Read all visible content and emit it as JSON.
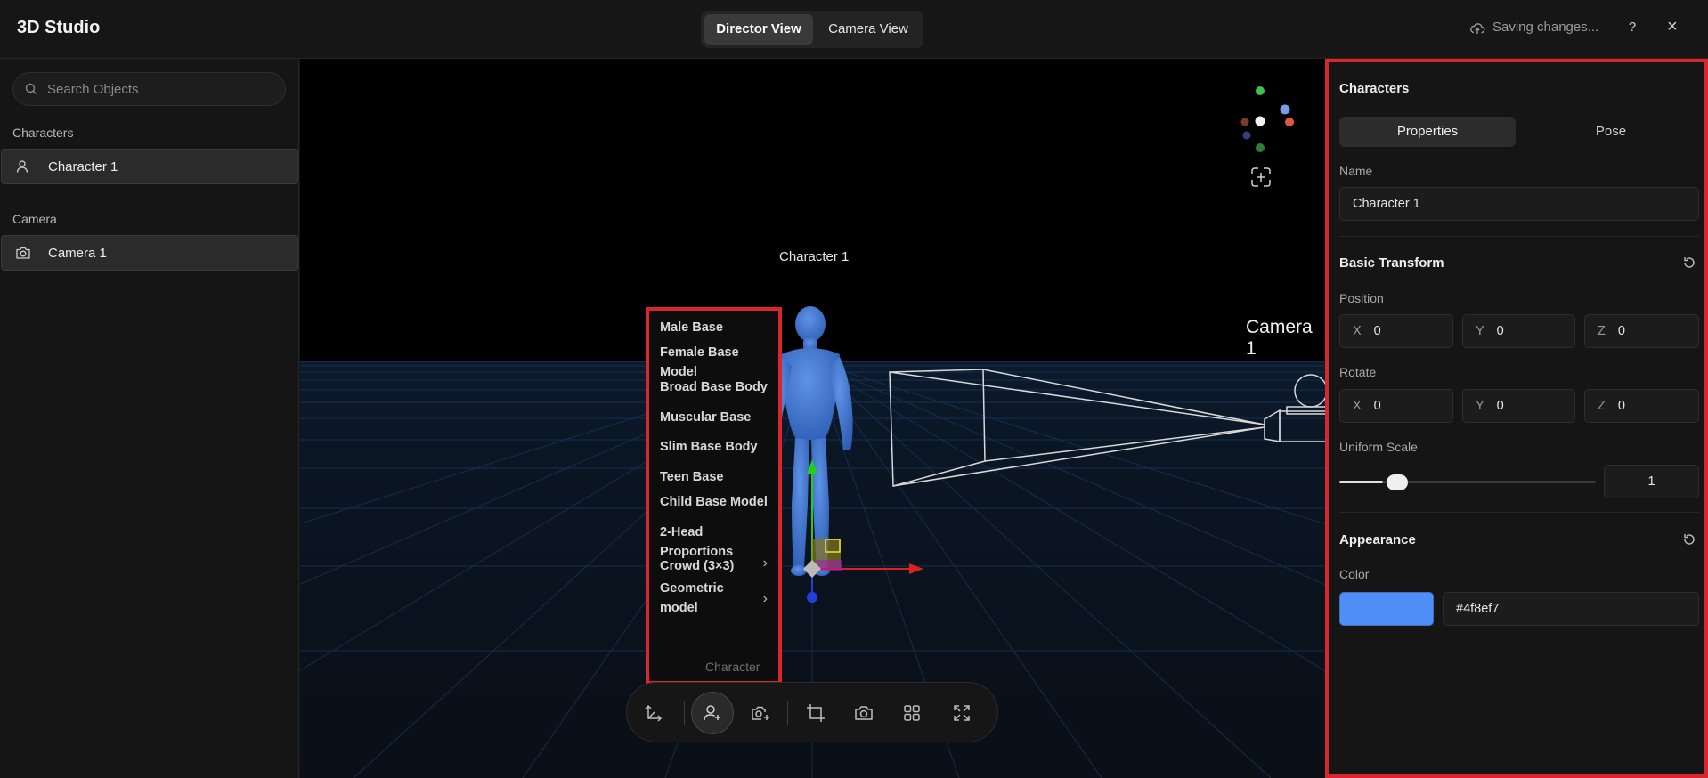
{
  "app": {
    "title": "3D Studio",
    "save_status": "Saving changes...",
    "help_label": "?",
    "close_label": "×"
  },
  "views": [
    {
      "label": "Director View",
      "active": true
    },
    {
      "label": "Camera View",
      "active": false
    }
  ],
  "sidebar": {
    "search_placeholder": "Search Objects",
    "sections": [
      {
        "label": "Characters",
        "items": [
          "Character 1"
        ]
      },
      {
        "label": "Camera",
        "items": [
          "Camera 1"
        ]
      }
    ]
  },
  "viewport": {
    "character_label": "Character 1",
    "camera_label": "Camera 1",
    "add_menu": {
      "items": [
        {
          "label": "Male Base",
          "submenu": false
        },
        {
          "label": "Female Base Model",
          "submenu": false
        },
        {
          "label": "Broad Base Body",
          "submenu": false
        },
        {
          "label": "Muscular Base",
          "submenu": false
        },
        {
          "label": "Slim Base Body",
          "submenu": false
        },
        {
          "label": "Teen Base",
          "submenu": false
        },
        {
          "label": "Child Base Model",
          "submenu": false
        },
        {
          "label": "2-Head Proportions",
          "submenu": false
        },
        {
          "label": "Crowd (3×3)",
          "submenu": true
        },
        {
          "label": "Geometric model",
          "submenu": true
        }
      ],
      "ghost_text": "Character"
    },
    "toolbar": [
      "axes-tool",
      "add-character-tool",
      "add-camera-tool",
      "crop-tool",
      "snapshot-tool",
      "grid-tool",
      "fullscreen-tool"
    ]
  },
  "panel": {
    "title": "Characters",
    "tabs": [
      {
        "label": "Properties",
        "active": true
      },
      {
        "label": "Pose",
        "active": false
      }
    ],
    "name_label": "Name",
    "name_value": "Character 1",
    "transform_title": "Basic Transform",
    "position_label": "Position",
    "position": {
      "x": "0",
      "y": "0",
      "z": "0"
    },
    "rotate_label": "Rotate",
    "rotate": {
      "x": "0",
      "y": "0",
      "z": "0"
    },
    "axis_labels": {
      "x": "X",
      "y": "Y",
      "z": "Z"
    },
    "scale_label": "Uniform Scale",
    "scale_value": "1",
    "scale_fraction": 0.17,
    "appearance_title": "Appearance",
    "color_label": "Color",
    "color_value": "#4f8ef7"
  },
  "colors": {
    "accent_red": "#d9262c",
    "character_blue": "#4f8ef7"
  }
}
